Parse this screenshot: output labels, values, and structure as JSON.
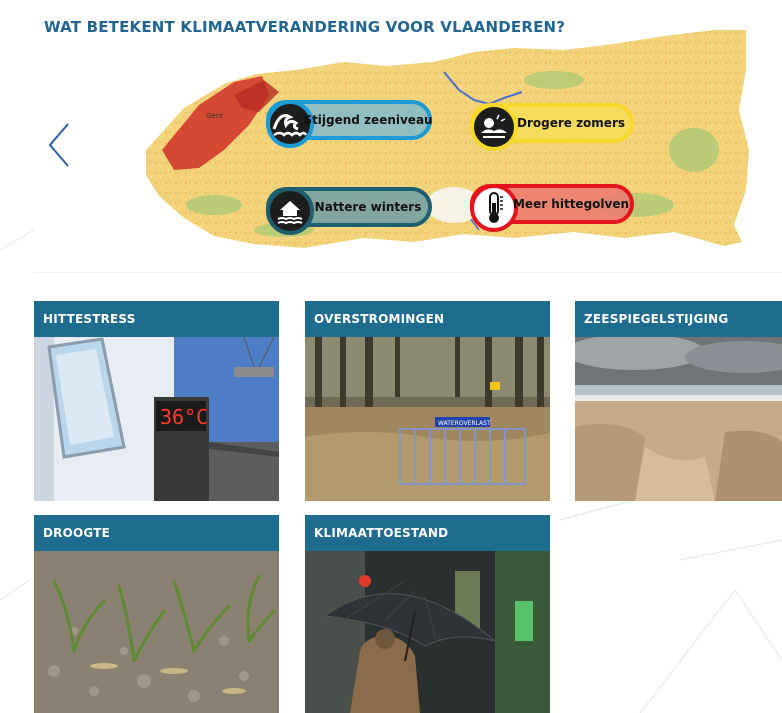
{
  "hero": {
    "title": "WAT BETEKENT KLIMAATVERANDERING VOOR VLAANDEREN?",
    "map_label": "Gent",
    "topics": [
      {
        "label": "Stijgend zeeniveau",
        "icon": "waves-icon",
        "color": "#1b9ad6"
      },
      {
        "label": "Drogere zomers",
        "icon": "drought-icon",
        "color": "#f6d92a"
      },
      {
        "label": "Nattere winters",
        "icon": "flooded-house-icon",
        "color": "#1f5e6e"
      },
      {
        "label": "Meer hittegolven",
        "icon": "thermometer-icon",
        "color": "#e3141b"
      }
    ]
  },
  "cards": [
    {
      "title": "HITTESTRESS",
      "thermometer_display": "36°C"
    },
    {
      "title": "OVERSTROMINGEN",
      "sign_text": "WATEROVERLAST"
    },
    {
      "title": "ZEESPIEGELSTIJGING"
    },
    {
      "title": "DROOGTE"
    },
    {
      "title": "KLIMAATTOESTAND"
    }
  ],
  "colors": {
    "accent": "#1e6d8f",
    "title": "#22668f"
  }
}
